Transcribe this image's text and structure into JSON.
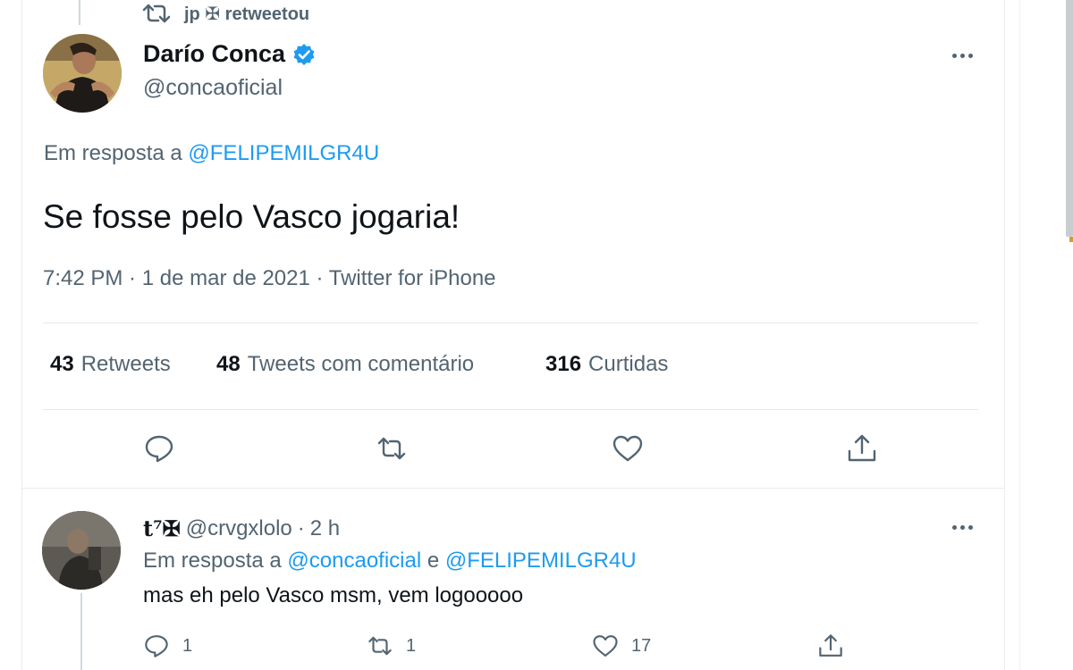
{
  "retweet_header": {
    "user": "jp",
    "emoji": "✠",
    "label": "retweetou"
  },
  "tweet": {
    "author_name": "Darío Conca",
    "author_handle": "@concaoficial",
    "reply_to_prefix": "Em resposta a",
    "reply_to_handle": "@FELIPEMILGR4U",
    "text": "Se fosse pelo Vasco jogaria!",
    "time": "7:42 PM",
    "separator1": " · ",
    "date": "1 de mar de 2021",
    "separator2": " · ",
    "source": "Twitter for iPhone",
    "stats": {
      "retweets_count": "43",
      "retweets_label": "Retweets",
      "quotes_count": "48",
      "quotes_label": "Tweets com comentário",
      "likes_count": "316",
      "likes_label": "Curtidas"
    }
  },
  "reply": {
    "author_name": "t⁷✠",
    "author_handle": "@crvgxlolo",
    "separator": "·",
    "time": "2 h",
    "reply_to_prefix": "Em resposta a",
    "reply_to_handle1": "@concaoficial",
    "reply_to_and": "e",
    "reply_to_handle2": "@FELIPEMILGR4U",
    "text": "mas eh pelo Vasco msm, vem logooooo",
    "reply_count": "1",
    "retweet_count": "1",
    "like_count": "17"
  },
  "icons": [
    "retweet-icon",
    "verified-icon",
    "more-icon",
    "reply-icon",
    "like-icon",
    "share-icon"
  ],
  "colors": {
    "accent": "#1d9bf0",
    "muted": "#536471",
    "text": "#0f1419"
  }
}
